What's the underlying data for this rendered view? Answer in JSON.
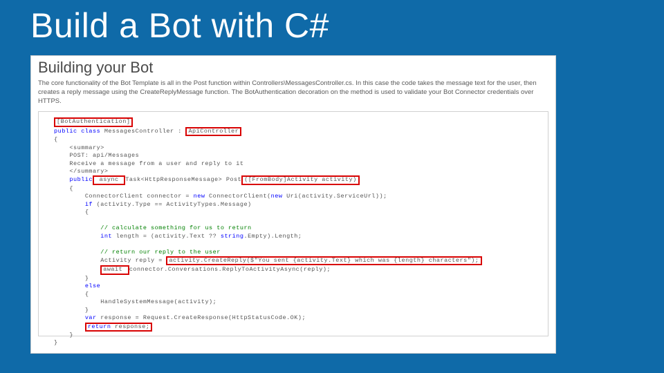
{
  "title": "Build a Bot with C#",
  "heading": "Building your Bot",
  "desc": "The core functionality of the Bot Template is all in the Post function within Controllers\\MessagesController.cs. In this case the code takes the message text for the user, then creates a reply message using the CreateReplyMessage function. The BotAuthentication decoration on the method is used to validate your Bot Connector credentials over HTTPS.",
  "code": {
    "l1": "[BotAuthentication]",
    "l2a": "public class",
    "l2b": " MessagesController : ",
    "l2c": "ApiController",
    "l3": "{",
    "l4": "<summary>",
    "l5": "POST: api/Messages",
    "l6": "Receive a message from a user and reply to it",
    "l7": "</summary>",
    "l8a": "public",
    "l8b": " async ",
    "l8c": "Task<HttpResponseMessage> Post",
    "l8d": "([FromBody]Activity activity)",
    "l9": "{",
    "l10a": "ConnectorClient connector = ",
    "l10b": "new",
    "l10c": " ConnectorClient(",
    "l10d": "new",
    "l10e": " Uri(activity.ServiceUrl));",
    "l11a": "if",
    "l11b": " (activity.Type == ActivityTypes.Message)",
    "l12": "{",
    "l13": "// calculate something for us to return",
    "l14a": "int",
    "l14b": " length = (activity.Text ?? ",
    "l14c": "string",
    "l14d": ".Empty).Length;",
    "l15": "// return our reply to the user",
    "l16a": "Activity reply = ",
    "l16b": "activity.CreateReply($\"You sent {activity.Text} which was {length} characters\");",
    "l17a": "await ",
    "l17b": "connector.Conversations.ReplyToActivityAsync(reply);",
    "l18": "}",
    "l19": "else",
    "l20": "{",
    "l21": "HandleSystemMessage(activity);",
    "l22": "}",
    "l23a": "var",
    "l23b": " response = Request.CreateResponse(HttpStatusCode.OK);",
    "l24a": "return",
    "l24b": " response;",
    "l25": "}",
    "l26": "}"
  }
}
